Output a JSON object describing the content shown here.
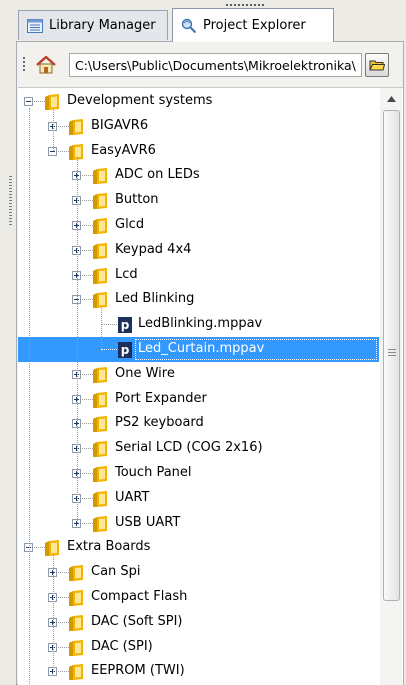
{
  "tabs": [
    {
      "label": "Library Manager",
      "icon": "library-icon",
      "active": false
    },
    {
      "label": "Project Explorer",
      "icon": "project-explorer-icon",
      "active": true
    }
  ],
  "pathbar": {
    "path": "C:\\Users\\Public\\Documents\\Mikroelektronika\\mikroPascal PRO for AVR\\Examples",
    "home_icon": "home-icon",
    "browse_icon": "open-folder-icon"
  },
  "tree": {
    "items": [
      {
        "label": "Development systems",
        "level": 0,
        "type": "folder",
        "expanded": true
      },
      {
        "label": "BIGAVR6",
        "level": 1,
        "type": "folder",
        "expanded": false
      },
      {
        "label": "EasyAVR6",
        "level": 1,
        "type": "folder",
        "expanded": true
      },
      {
        "label": "ADC on LEDs",
        "level": 2,
        "type": "folder",
        "expanded": false
      },
      {
        "label": "Button",
        "level": 2,
        "type": "folder",
        "expanded": false
      },
      {
        "label": "Glcd",
        "level": 2,
        "type": "folder",
        "expanded": false
      },
      {
        "label": "Keypad 4x4",
        "level": 2,
        "type": "folder",
        "expanded": false
      },
      {
        "label": "Lcd",
        "level": 2,
        "type": "folder",
        "expanded": false
      },
      {
        "label": "Led Blinking",
        "level": 2,
        "type": "folder",
        "expanded": true
      },
      {
        "label": "LedBlinking.mppav",
        "level": 3,
        "type": "file"
      },
      {
        "label": "Led_Curtain.mppav",
        "level": 3,
        "type": "file",
        "selected": true
      },
      {
        "label": "One Wire",
        "level": 2,
        "type": "folder",
        "expanded": false
      },
      {
        "label": "Port Expander",
        "level": 2,
        "type": "folder",
        "expanded": false
      },
      {
        "label": "PS2 keyboard",
        "level": 2,
        "type": "folder",
        "expanded": false
      },
      {
        "label": "Serial LCD (COG 2x16)",
        "level": 2,
        "type": "folder",
        "expanded": false
      },
      {
        "label": "Touch Panel",
        "level": 2,
        "type": "folder",
        "expanded": false
      },
      {
        "label": "UART",
        "level": 2,
        "type": "folder",
        "expanded": false
      },
      {
        "label": "USB UART",
        "level": 2,
        "type": "folder",
        "expanded": false
      },
      {
        "label": "Extra Boards",
        "level": 0,
        "type": "folder",
        "expanded": true
      },
      {
        "label": "Can Spi",
        "level": 1,
        "type": "folder",
        "expanded": false
      },
      {
        "label": "Compact Flash",
        "level": 1,
        "type": "folder",
        "expanded": false
      },
      {
        "label": "DAC (Soft SPI)",
        "level": 1,
        "type": "folder",
        "expanded": false
      },
      {
        "label": "DAC (SPI)",
        "level": 1,
        "type": "folder",
        "expanded": false
      },
      {
        "label": "EEPROM (TWI)",
        "level": 1,
        "type": "folder",
        "expanded": false
      }
    ],
    "file_glyph": "p"
  },
  "colors": {
    "selection": "#3399ff",
    "folder": "#f2b400",
    "file_icon": "#1d2f5c"
  }
}
